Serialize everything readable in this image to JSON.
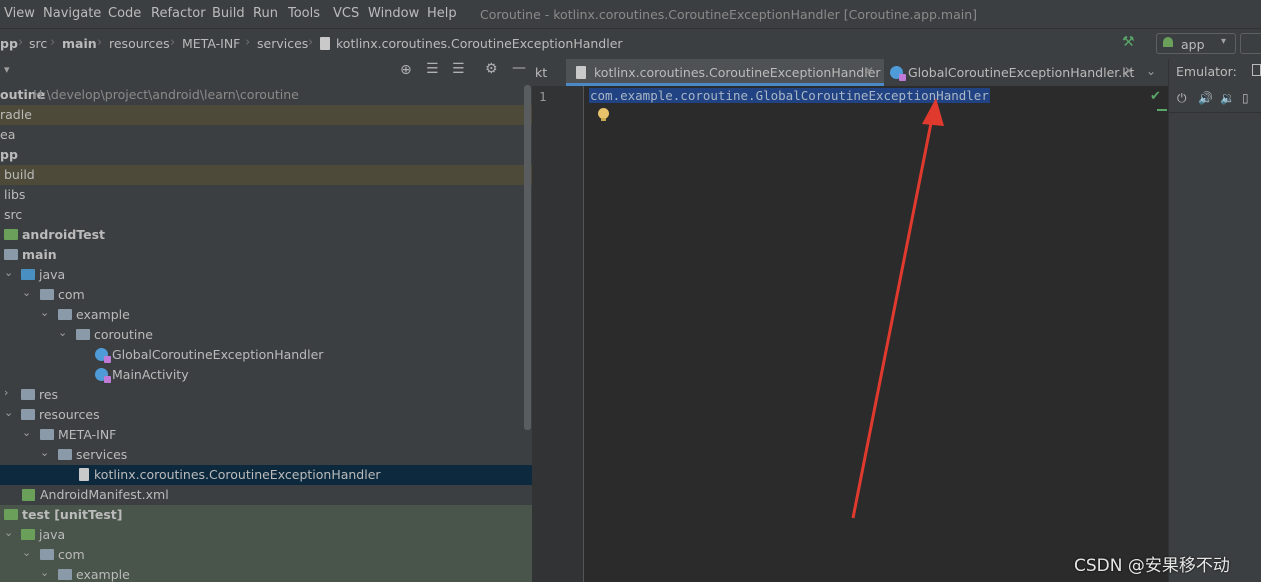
{
  "menu": {
    "items": [
      "View",
      "Navigate",
      "Code",
      "Refactor",
      "Build",
      "Run",
      "Tools",
      "VCS",
      "Window",
      "Help"
    ],
    "window_title": "Coroutine - kotlinx.coroutines.CoroutineExceptionHandler [Coroutine.app.main]"
  },
  "breadcrumbs": [
    "pp",
    "src",
    "main",
    "resources",
    "META-INF",
    "services",
    "kotlinx.coroutines.CoroutineExceptionHandler"
  ],
  "run_config": "app",
  "project_tree": {
    "root": {
      "label": "outine",
      "path": "H:\\develop\\project\\android\\learn\\coroutine"
    },
    "rows": [
      {
        "label": "radle"
      },
      {
        "label": "ea"
      },
      {
        "label": "pp"
      },
      {
        "label": "build"
      },
      {
        "label": "libs"
      },
      {
        "label": "src"
      },
      {
        "label": "androidTest"
      },
      {
        "label": "main"
      },
      {
        "label": "java"
      },
      {
        "label": "com"
      },
      {
        "label": "example"
      },
      {
        "label": "coroutine"
      },
      {
        "label": "GlobalCoroutineExceptionHandler"
      },
      {
        "label": "MainActivity"
      },
      {
        "label": "res"
      },
      {
        "label": "resources"
      },
      {
        "label": "META-INF"
      },
      {
        "label": "services"
      },
      {
        "label": "kotlinx.coroutines.CoroutineExceptionHandler"
      },
      {
        "label": "AndroidManifest.xml"
      },
      {
        "label": "test [unitTest]"
      },
      {
        "label": "java"
      },
      {
        "label": "com"
      },
      {
        "label": "example"
      }
    ]
  },
  "editor": {
    "tabs": [
      {
        "label": "kt"
      },
      {
        "label": "kotlinx.coroutines.CoroutineExceptionHandler"
      },
      {
        "label": "GlobalCoroutineExceptionHandler.kt"
      }
    ],
    "line_number": "1",
    "code": "com.example.coroutine.GlobalCoroutineExceptionHandler"
  },
  "emulator": {
    "title": "Emulator:"
  },
  "watermark": "CSDN @安果移不动",
  "colors": {
    "selection": "#214283",
    "accent_tab": "#4a88c7",
    "highlight_row": "#4e4a39",
    "selected_row": "#0d293e",
    "arrow": "#e03a2f"
  }
}
